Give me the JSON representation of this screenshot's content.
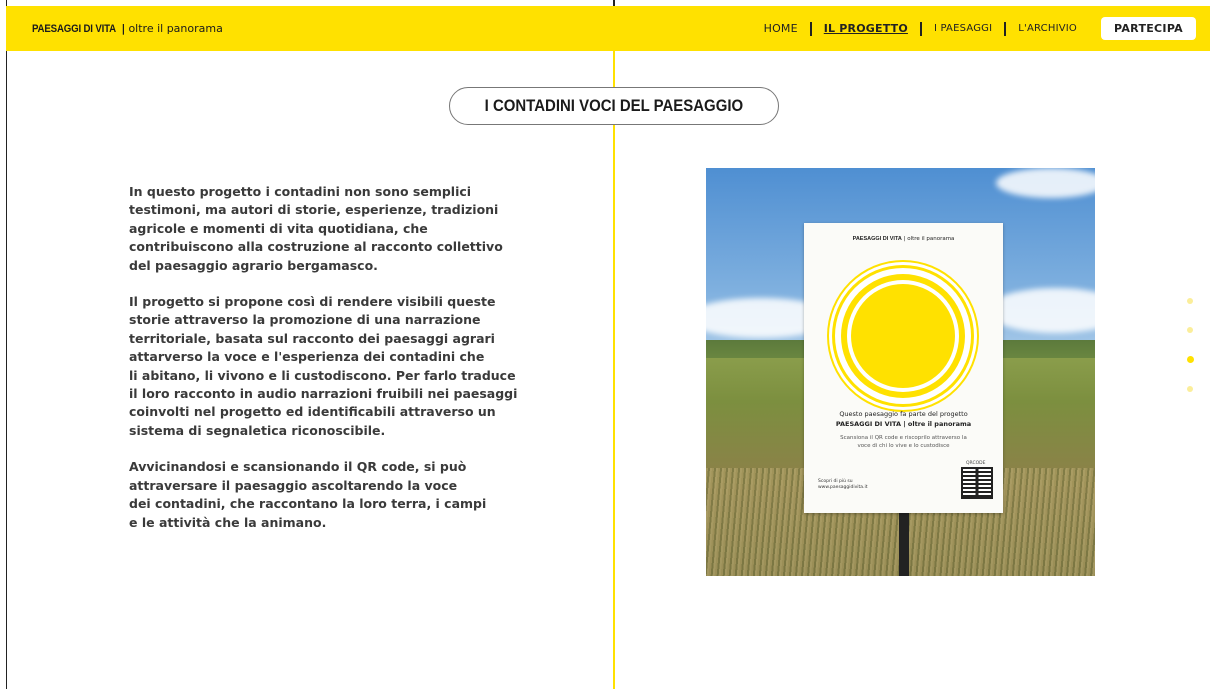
{
  "header": {
    "brand_name": "PAESAGGI DI VITA",
    "brand_separator": "|",
    "brand_tagline": "oltre il panorama",
    "nav": [
      {
        "label": "HOME",
        "active": false
      },
      {
        "label": "IL PROGETTO",
        "active": true
      },
      {
        "label": "I PAESAGGI",
        "active": false
      },
      {
        "label": "L'ARCHIVIO",
        "active": false
      }
    ],
    "cta_label": "PARTECIPA"
  },
  "section": {
    "title": "I CONTADINI VOCI DEL PAESAGGIO"
  },
  "content": {
    "paragraphs": [
      "In questo progetto i contadini non sono semplici\ntestimoni, ma autori di storie, esperienze, tradizioni\nagricole e momenti di vita quotidiana, che\ncontribuiscono alla costruzione al racconto collettivo\ndel paesaggio agrario bergamasco.",
      "Il progetto si propone così di rendere visibili queste\nstorie attraverso la promozione di una narrazione\nterritoriale, basata sul racconto dei paesaggi agrari\nattarverso la voce e l'esperienza dei contadini che\nli abitano, li vivono e li custodiscono. Per farlo traduce\nil loro racconto in audio narrazioni fruibili nei paesaggi\ncoinvolti nel progetto ed identificabili attraverso un\nsistema di segnaletica riconoscibile.",
      "Avvicinandosi e scansionando il QR code, si può\nattraversare il paesaggio ascoltarendo la voce\ndei contadini, che raccontano la loro terra, i campi\ne le attività che la animano."
    ]
  },
  "photo_sign": {
    "brand_name": "PAESAGGI DI VITA",
    "brand_tagline": "| oltre il panorama",
    "line1": "Questo paesaggio fa parte del progetto",
    "line2": "PAESAGGI DI VITA | oltre il panorama",
    "line3": "Scansiona il QR code e riscoprilo attraverso la",
    "line4": "voce di chi lo vive e lo custodisce",
    "qr_label": "QRCODE",
    "footer_line1": "Scopri di più su",
    "footer_line2": "www.paesaggidivita.it"
  },
  "side_nav": {
    "dot_count": 4,
    "active_index": 2
  },
  "colors": {
    "accent": "#ffe100",
    "text": "#3a3a3a",
    "dot_inactive": "#fbee9a"
  }
}
